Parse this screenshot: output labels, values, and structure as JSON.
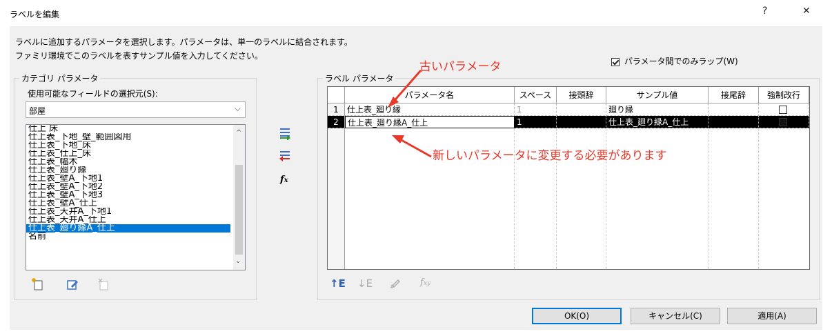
{
  "window": {
    "title": "ラベルを編集",
    "help_label": "?",
    "close_label": "✕"
  },
  "description": {
    "line1": "ラベルに追加するパラメータを選択します。パラメータは、単一のラベルに結合されます。",
    "line2": "ファミリ環境でこのラベルを表すサンプル値を入力してください。"
  },
  "wrap_option": {
    "label": "パラメータ間でのみラップ(W)",
    "checked": true
  },
  "category_group": {
    "label": "カテゴリ パラメータ",
    "field_label": "使用可能なフィールドの選択元(S):",
    "selected_source": "部屋",
    "items": [
      {
        "label": "仕上 床"
      },
      {
        "label": "仕上表_下地_壁_範囲図用"
      },
      {
        "label": "仕上表_下地_床"
      },
      {
        "label": "仕上表_仕上_床"
      },
      {
        "label": "仕上表_幅木"
      },
      {
        "label": "仕上表_廻り縁"
      },
      {
        "label": "仕上表_壁A_下地1"
      },
      {
        "label": "仕上表_壁A_下地2"
      },
      {
        "label": "仕上表_壁A_下地3"
      },
      {
        "label": "仕上表_壁A_仕上"
      },
      {
        "label": "仕上表_天井A_下地1"
      },
      {
        "label": "仕上表_天井A_仕上"
      },
      {
        "label": "仕上表_廻り縁A_仕上"
      },
      {
        "label": "名前"
      }
    ],
    "selected_index": 12
  },
  "transfer_icons": {
    "add": "add-parameter-icon",
    "remove": "remove-parameter-icon",
    "formula": "fx-icon"
  },
  "label_group": {
    "label": "ラベル パラメータ",
    "columns": [
      "パラメータ名",
      "スペース",
      "接頭辞",
      "サンプル値",
      "接尾辞",
      "強制改行"
    ],
    "rows": [
      {
        "num": "1",
        "name": "仕上表_廻り縁",
        "space": "1",
        "prefix": "",
        "sample": "廻り縁",
        "suffix": "",
        "break": false
      },
      {
        "num": "2",
        "name": "仕上表_廻り縁A_仕上",
        "space": "1",
        "prefix": "",
        "sample": "仕上表_廻り縁A_仕上",
        "suffix": "",
        "break": false
      }
    ]
  },
  "annotations": {
    "old_param": "古いパラメータ",
    "new_param_note": "新しいパラメータに変更する必要があります",
    "color": "#e8382a"
  },
  "buttons": {
    "ok": "OK(O)",
    "cancel": "キャンセル(C)",
    "apply": "適用(A)"
  },
  "colors": {
    "selection": "#0078d7",
    "selected_row": "#000000",
    "dialog_bg": "#f0f0f0"
  }
}
